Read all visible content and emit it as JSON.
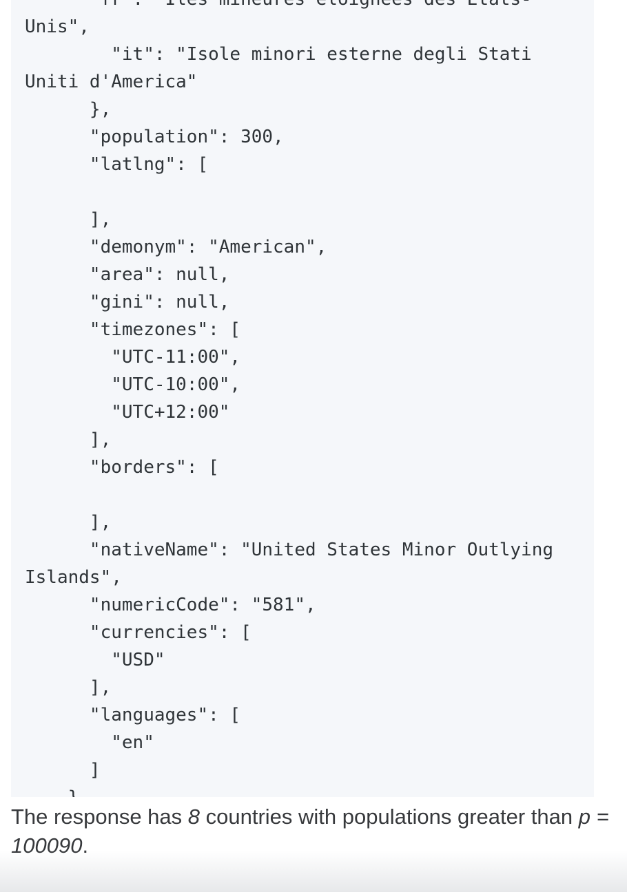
{
  "code": {
    "lines": [
      "  \"fr\": \"Îles mineures éloignées des États-Unis\",",
      "    \"it\": \"Isole minori esterne degli Stati Uniti d'America\"",
      "  },",
      "  \"population\": 300,",
      "  \"latlng\": [",
      "",
      "  ],",
      "  \"demonym\": \"American\",",
      "  \"area\": null,",
      "  \"gini\": null,",
      "  \"timezones\": [",
      "    \"UTC-11:00\",",
      "    \"UTC-10:00\",",
      "    \"UTC+12:00\"",
      "  ],",
      "  \"borders\": [",
      "",
      "  ],",
      "  \"nativeName\": \"United States Minor Outlying Islands\",",
      "  \"numericCode\": \"581\",",
      "  \"currencies\": [",
      "    \"USD\"",
      "  ],",
      "  \"languages\": [",
      "    \"en\"",
      "  ]",
      "}...."
    ]
  },
  "caption": {
    "prefix": "The response has ",
    "count": "8",
    "middle": " countries with populations greater than ",
    "condition": "p = 100090",
    "suffix": "."
  }
}
